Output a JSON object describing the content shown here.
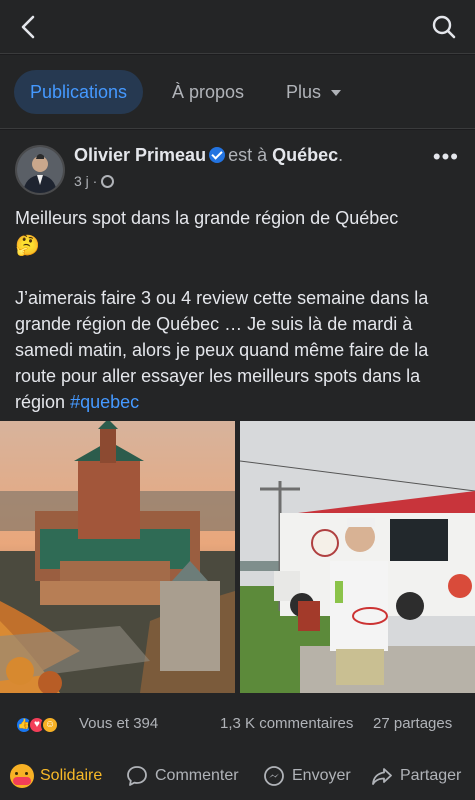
{
  "tabs": [
    {
      "label": "Publications"
    },
    {
      "label": "À propos"
    },
    {
      "label": "Plus"
    }
  ],
  "post": {
    "author": "Olivier Primeau",
    "est_a": "est à",
    "location": "Québec",
    "location_suffix": ".",
    "time": "3 j ·",
    "text_line1": "Meilleurs spot dans la grande région de Québec",
    "text_emoji": "🤔",
    "text_body": "J’aimerais faire 3 ou 4 review cette semaine dans la grande région de Québec … Je suis là de mardi à samedi matin, alors je peux quand même faire de la route pour aller essayer les meilleurs spots dans la région",
    "hashtag": "#quebec"
  },
  "stats": {
    "reactors": "Vous et 394",
    "comments": "1,3 K commentaires",
    "shares": "27 partages"
  },
  "actions": {
    "solidaire": "Solidaire",
    "comment": "Commenter",
    "send": "Envoyer",
    "share": "Partager"
  },
  "colors": {
    "accent": "#4599ff",
    "background": "#242526",
    "solidaire": "#f7b928"
  }
}
